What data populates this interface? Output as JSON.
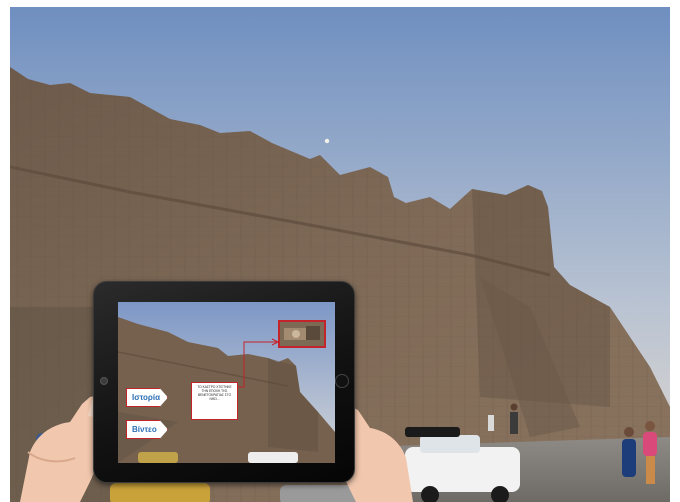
{
  "ar_overlay": {
    "history_label": "Ιστορία",
    "video_label": "Βίντεο",
    "info_text": "ΤΟ ΚΑΣΤΡΟ ΧΤΙΣΤΗΚΕ ΤΗΝ ΕΠΟΧΗ ΤΗΣ ΒΕΝΕΤΟΚΡΑΤΙΑΣ ΣΤΟ ΝΗΣΙ..."
  },
  "colors": {
    "sky_top": "#6f8fc0",
    "sky_bottom": "#d9dcde",
    "wall": "#7a6553",
    "accent_red": "#c3242a",
    "button_text": "#2d6fb4"
  }
}
